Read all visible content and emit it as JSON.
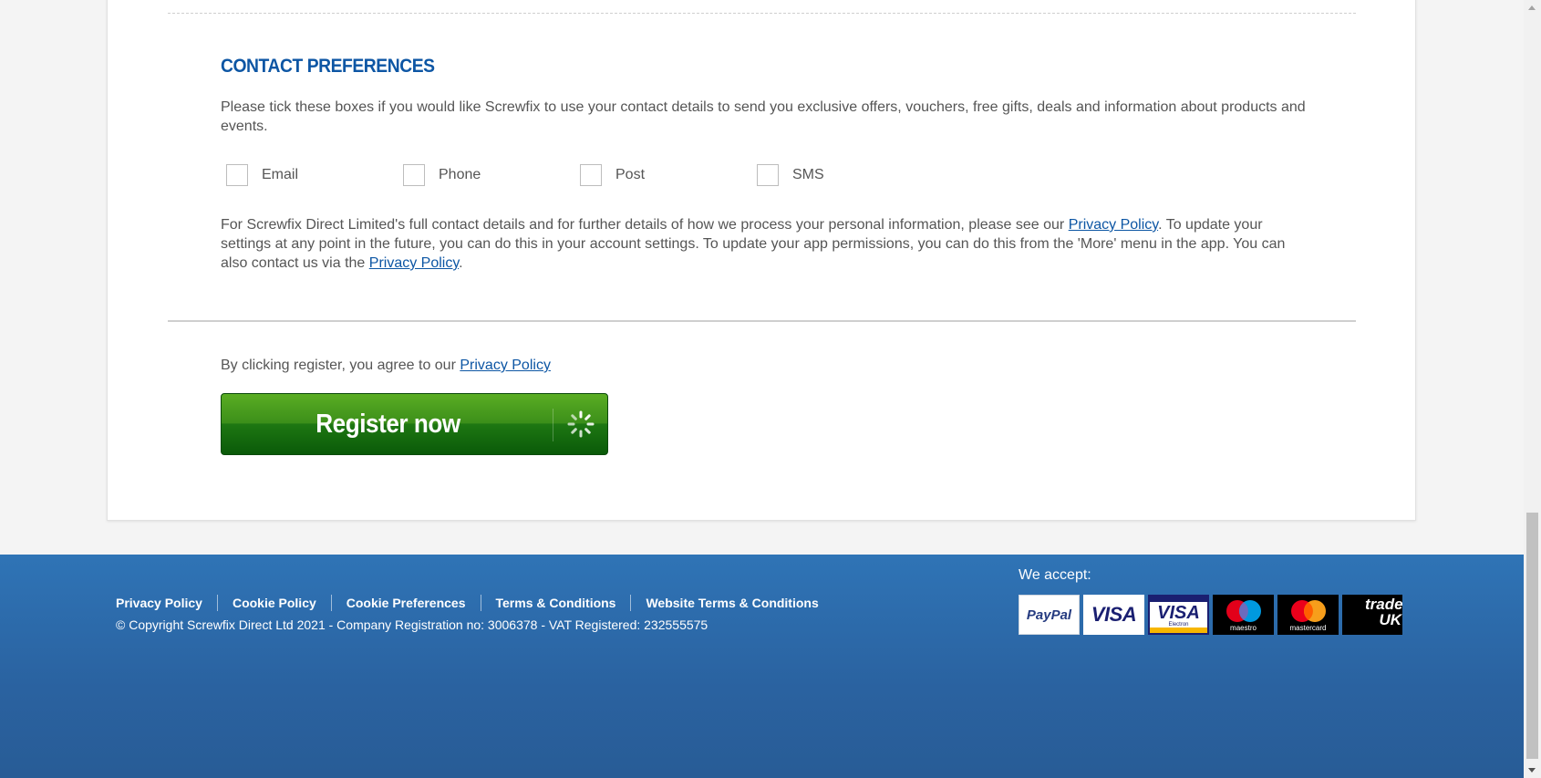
{
  "contact": {
    "title": "CONTACT PREFERENCES",
    "intro": "Please tick these boxes if you would like Screwfix to use your contact details to send you exclusive offers, vouchers, free gifts, deals and information about products and events.",
    "options": [
      {
        "label": "Email",
        "checked": false
      },
      {
        "label": "Phone",
        "checked": false
      },
      {
        "label": "Post",
        "checked": false
      },
      {
        "label": "SMS",
        "checked": false
      }
    ],
    "details_1": "For Screwfix Direct Limited's full contact details and for further details of how we process your personal information, please see our ",
    "details_link_1": "Privacy Policy",
    "details_2": ". To update your settings at any point in the future, you can do this in your account settings. To update your app permissions, you can do this from the 'More' menu in the app. You can also contact us via the ",
    "details_link_2": "Privacy Policy",
    "details_3": "."
  },
  "register": {
    "agree_text": "By clicking register, you agree to our ",
    "agree_link": "Privacy Policy",
    "button_label": "Register now",
    "loading": true
  },
  "footer": {
    "links": [
      "Privacy Policy",
      "Cookie Policy",
      "Cookie Preferences",
      "Terms & Conditions",
      "Website Terms & Conditions"
    ],
    "copyright": "© Copyright Screwfix Direct Ltd 2021 - Company Registration no: 3006378 - VAT Registered: 232555575",
    "accept_label": "We accept:",
    "payment_cards": [
      {
        "name": "paypal",
        "label": "PayPal"
      },
      {
        "name": "visa",
        "label": "VISA"
      },
      {
        "name": "visa-electron",
        "label": "VISA",
        "sublabel": "Electron"
      },
      {
        "name": "maestro",
        "label": "maestro"
      },
      {
        "name": "mastercard",
        "label": "mastercard"
      },
      {
        "name": "trade-uk",
        "label": "trade UK"
      }
    ]
  },
  "colors": {
    "heading_blue": "#0d56a4",
    "link_blue": "#0d56a4",
    "button_green": "#3c8f1a",
    "footer_blue": "#2f74b6"
  }
}
